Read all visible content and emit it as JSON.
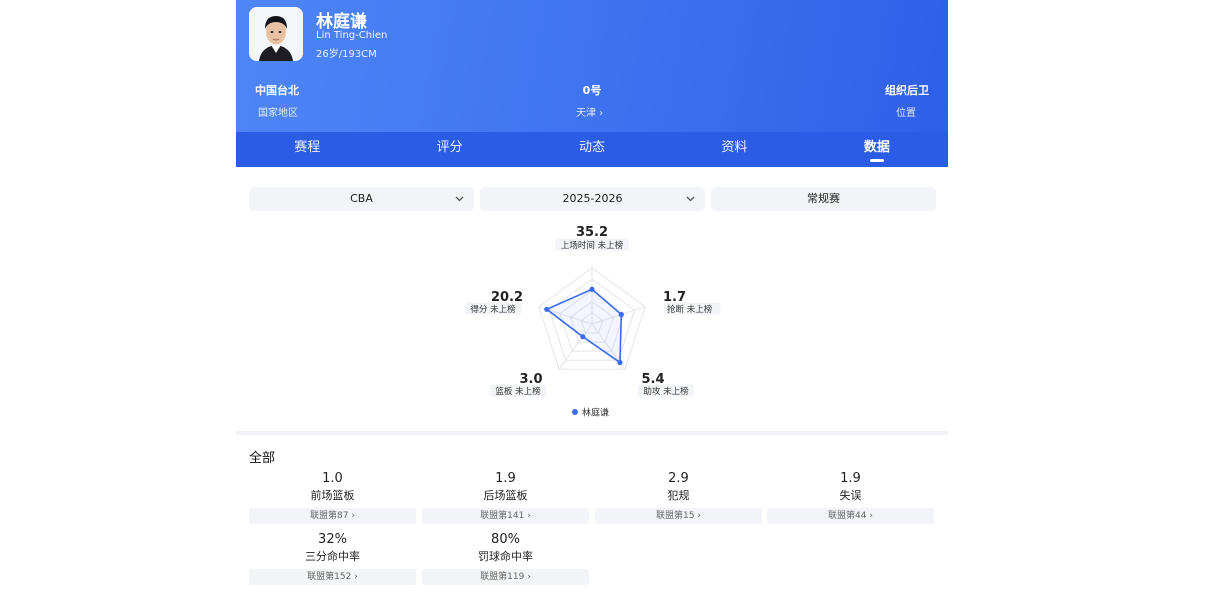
{
  "player": {
    "name": "林庭谦",
    "name_en": "Lin Ting-Chien",
    "age_height": "26岁/193CM",
    "region": "中国台北",
    "region_label": "国家地区",
    "number": "0号",
    "team": "天津 ›",
    "position": "组织后卫",
    "position_label": "位置"
  },
  "tabs": [
    {
      "label": "赛程"
    },
    {
      "label": "评分"
    },
    {
      "label": "动态"
    },
    {
      "label": "资料"
    },
    {
      "label": "数据",
      "active": true
    }
  ],
  "filters": {
    "league": "CBA",
    "season": "2025-2026",
    "stage": "常规赛"
  },
  "chart_data": {
    "type": "radar",
    "legend": "林庭谦",
    "axes": [
      {
        "value": "35.2",
        "label": "上场时间 未上榜",
        "norm": 0.62
      },
      {
        "value": "1.7",
        "label": "抢断 未上榜",
        "norm": 0.55
      },
      {
        "value": "5.4",
        "label": "助攻 未上榜",
        "norm": 0.85
      },
      {
        "value": "3.0",
        "label": "篮板 未上榜",
        "norm": 0.28
      },
      {
        "value": "20.2",
        "label": "得分 未上榜",
        "norm": 0.85
      }
    ],
    "colors": {
      "series": "#3b6cf0",
      "grid": "#e3e5ea"
    }
  },
  "section": {
    "title": "全部"
  },
  "stats": [
    {
      "value": "1.0",
      "label": "前场篮板",
      "rank": "联盟第87 ›"
    },
    {
      "value": "1.9",
      "label": "后场篮板",
      "rank": "联盟第141 ›"
    },
    {
      "value": "2.9",
      "label": "犯规",
      "rank": "联盟第15 ›"
    },
    {
      "value": "1.9",
      "label": "失误",
      "rank": "联盟第44 ›"
    },
    {
      "value": "32%",
      "label": "三分命中率",
      "rank": "联盟第152 ›"
    },
    {
      "value": "80%",
      "label": "罚球命中率",
      "rank": "联盟第119 ›"
    }
  ]
}
